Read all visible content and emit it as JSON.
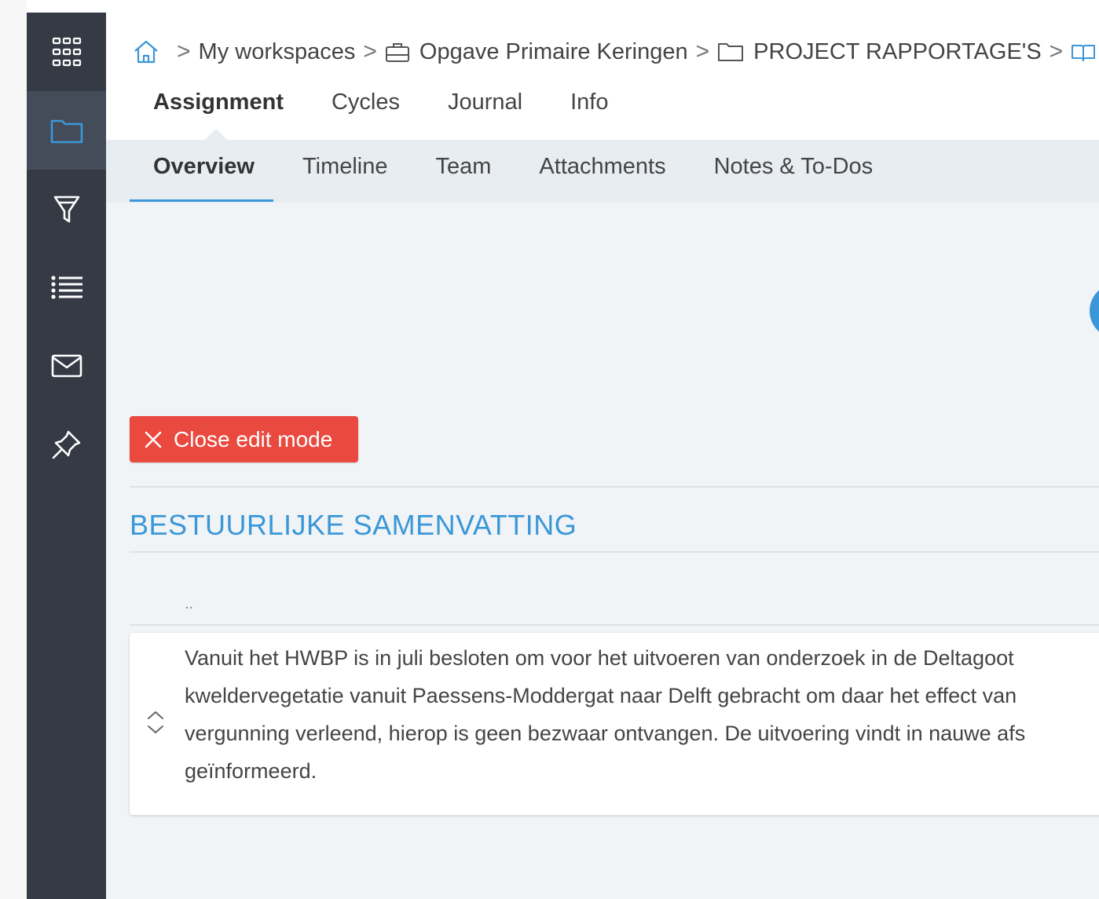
{
  "sidebar": {
    "items": [
      {
        "icon": "apps-grid-icon"
      },
      {
        "icon": "folder-icon"
      },
      {
        "icon": "filter-icon"
      },
      {
        "icon": "list-icon"
      },
      {
        "icon": "mail-icon"
      },
      {
        "icon": "pin-icon"
      }
    ]
  },
  "breadcrumb": {
    "home_icon": "home-icon",
    "items": [
      {
        "label": "My workspaces"
      },
      {
        "label": "Opgave Primaire Keringen",
        "icon": "briefcase-icon"
      },
      {
        "label": "PROJECT RAPPORTAGE'S",
        "icon": "folder-icon"
      },
      {
        "icon": "book-icon"
      }
    ]
  },
  "tabs": [
    "Assignment",
    "Cycles",
    "Journal",
    "Info"
  ],
  "subtabs": [
    "Overview",
    "Timeline",
    "Team",
    "Attachments",
    "Notes & To-Dos"
  ],
  "close_edit": {
    "label": "Close edit mode",
    "color": "#e9493f"
  },
  "section": {
    "title": "BESTUURLIJKE SAMENVATTING",
    "dots": "..",
    "lines": [
      "Vanuit het HWBP is in juli besloten om voor het uitvoeren van onderzoek in de Deltagoot",
      "kweldervegetatie vanuit Paessens-Moddergat naar Delft gebracht om daar het effect van",
      "vergunning verleend, hierop is geen bezwaar ontvangen. De uitvoering vindt in nauwe afs",
      "geïnformeerd."
    ]
  },
  "colors": {
    "accent": "#3a97d8",
    "sidebar": "#353a45",
    "sidebar_active": "#444b59",
    "danger": "#e9493f"
  }
}
